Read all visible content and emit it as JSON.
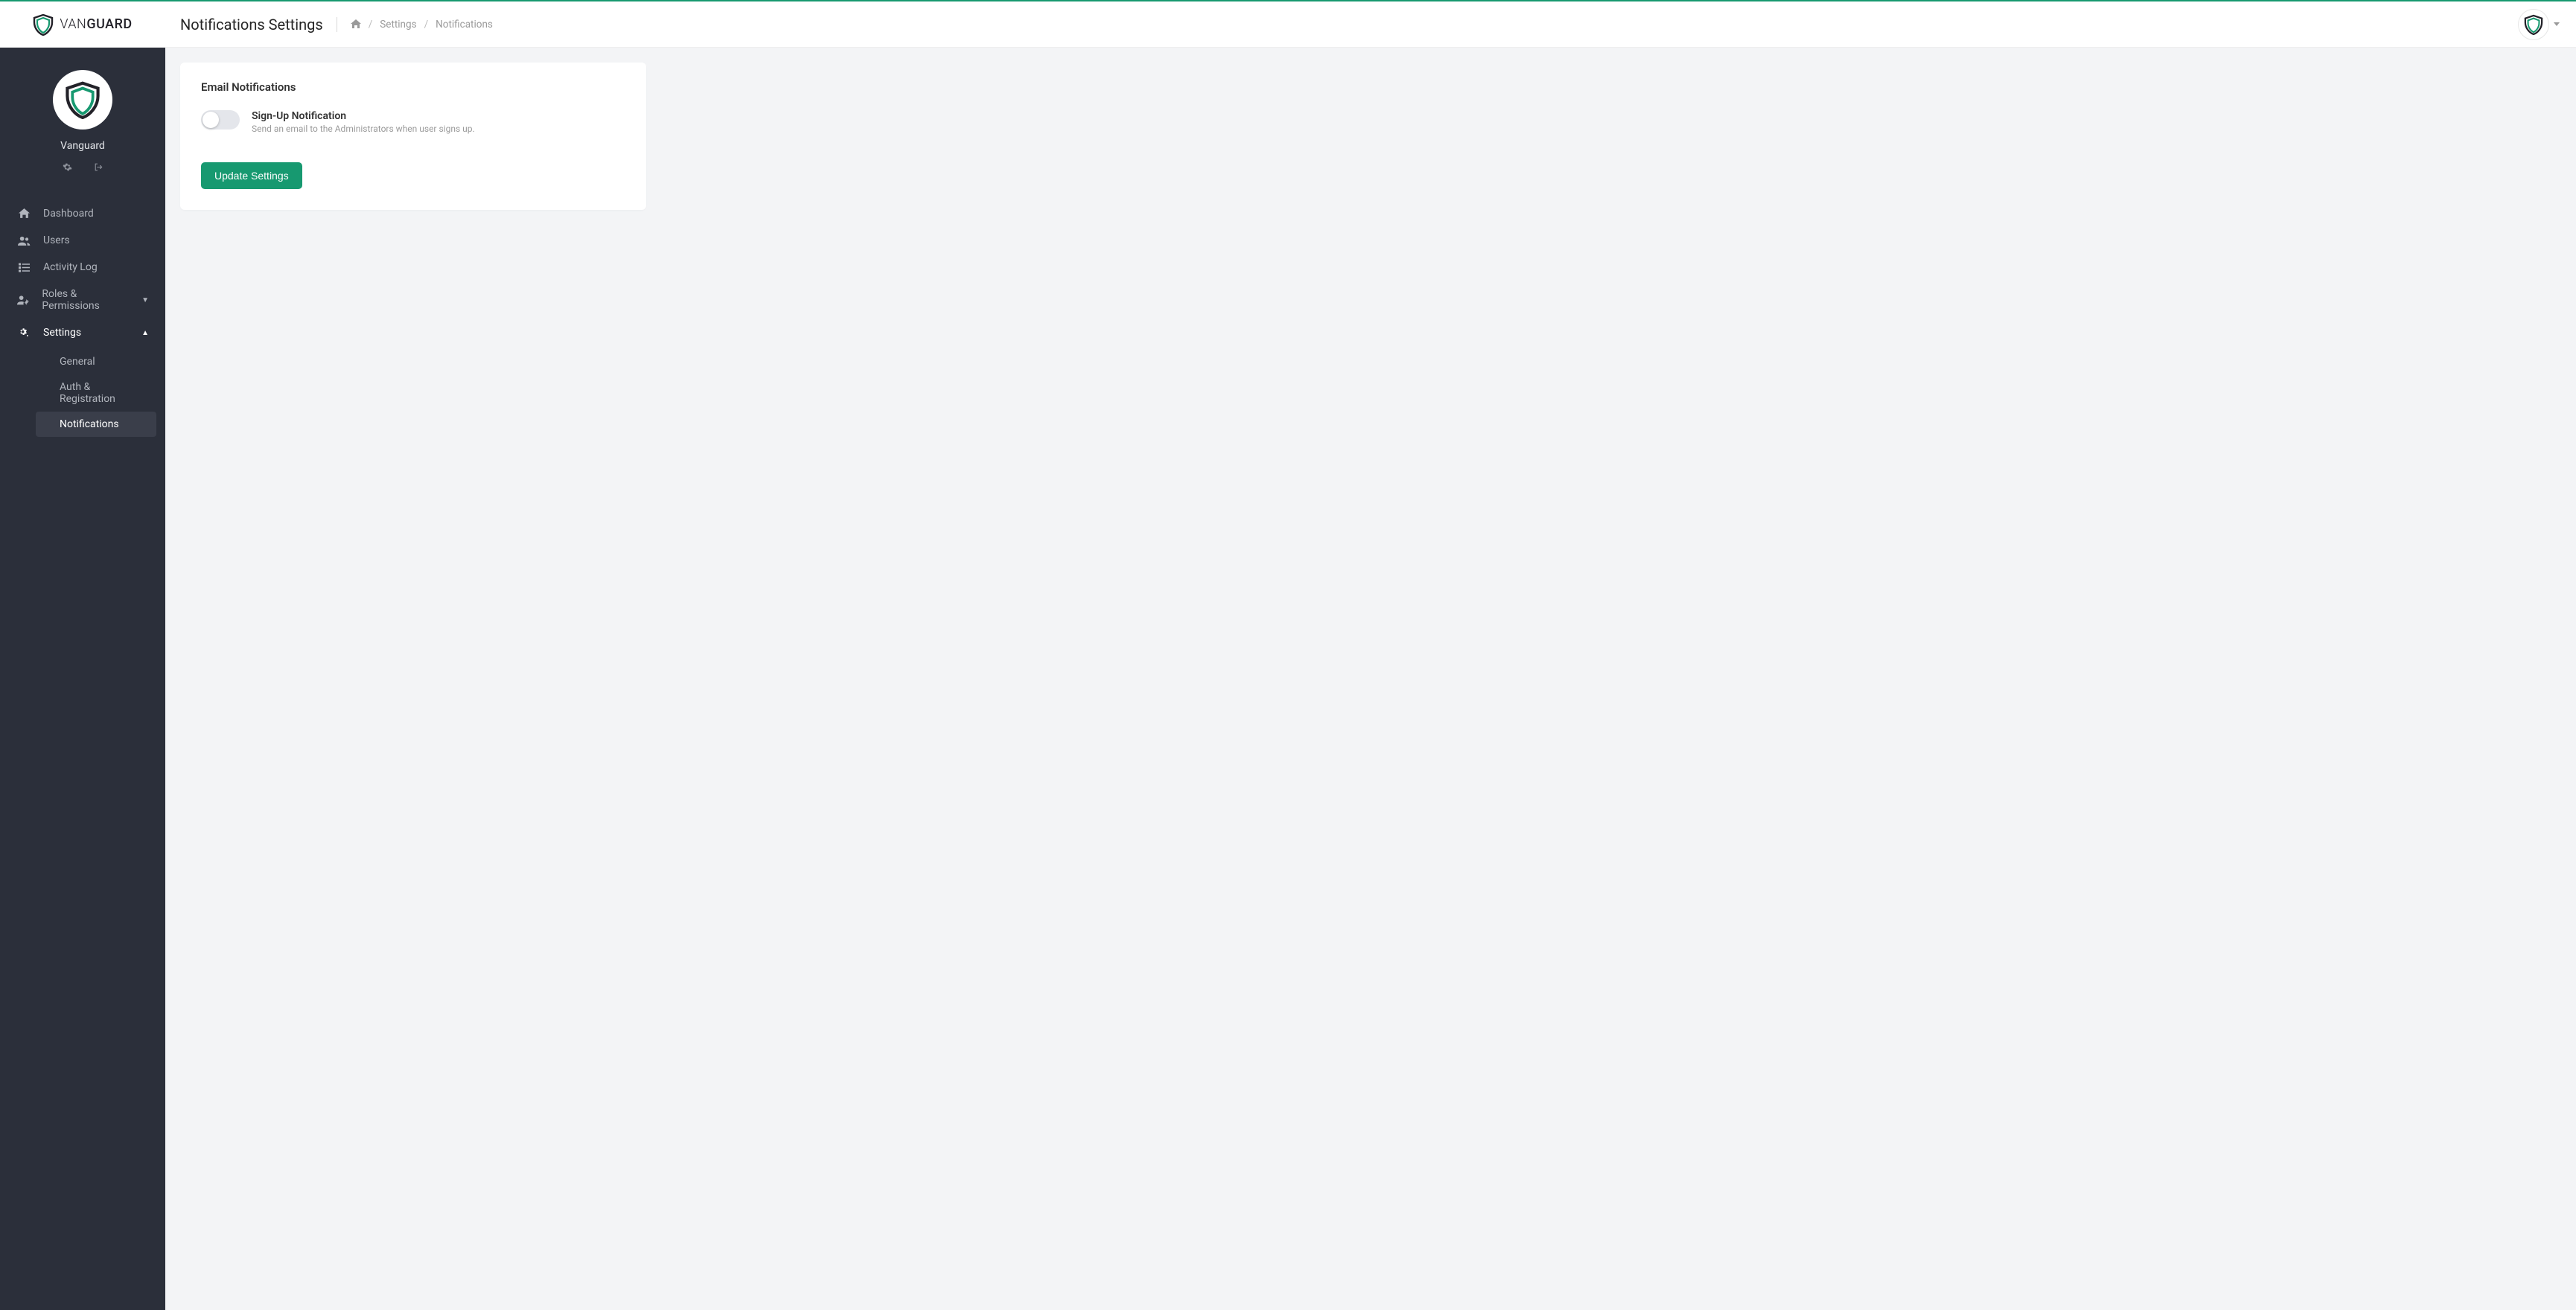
{
  "brand": {
    "name_light": "VAN",
    "name_bold": "GUARD"
  },
  "header": {
    "page_title": "Notifications Settings",
    "breadcrumb": {
      "settings": "Settings",
      "current": "Notifications"
    }
  },
  "sidebar": {
    "profile_name": "Vanguard",
    "items": [
      {
        "label": "Dashboard"
      },
      {
        "label": "Users"
      },
      {
        "label": "Activity Log"
      },
      {
        "label": "Roles & Permissions"
      },
      {
        "label": "Settings"
      }
    ],
    "settings_sub": [
      {
        "label": "General"
      },
      {
        "label": "Auth & Registration"
      },
      {
        "label": "Notifications"
      }
    ]
  },
  "card": {
    "title": "Email Notifications",
    "setting": {
      "label": "Sign-Up Notification",
      "description": "Send an email to the Administrators when user signs up."
    },
    "button": "Update Settings"
  }
}
